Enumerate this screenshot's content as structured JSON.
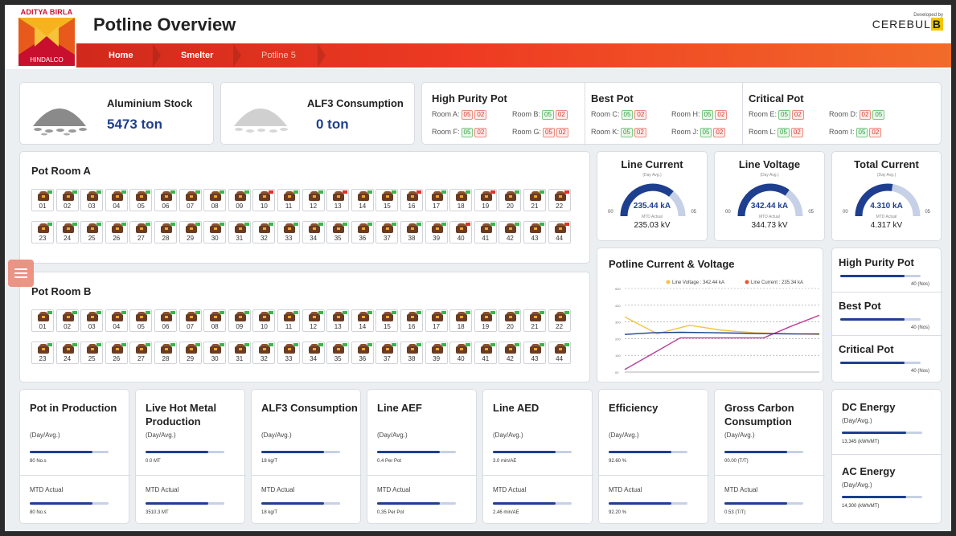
{
  "header": {
    "title": "Potline Overview",
    "logo_top": "ADITYA BIRLA",
    "logo_bottom": "HINDALCO",
    "developed_by": "Developed by",
    "developer": "CEREBUL",
    "developer_suffix": "B"
  },
  "breadcrumb": [
    "Home",
    "Smelter",
    "Potline 5"
  ],
  "stocks": {
    "aluminium": {
      "label": "Aluminium Stock",
      "value": "5473 ton"
    },
    "alf3": {
      "label": "ALF3 Consumption",
      "value": "0 ton"
    }
  },
  "pot_groups": [
    {
      "title": "High Purity Pot",
      "rooms": [
        {
          "label": "Room A:",
          "a": "05",
          "b": "02",
          "a_color": "r",
          "b_color": "r"
        },
        {
          "label": "Room B:",
          "a": "05",
          "b": "02",
          "a_color": "g",
          "b_color": "r"
        },
        {
          "label": "Room F:",
          "a": "05",
          "b": "02",
          "a_color": "g",
          "b_color": "r"
        },
        {
          "label": "Room G:",
          "a": "05",
          "b": "02",
          "a_color": "r",
          "b_color": "r"
        }
      ]
    },
    {
      "title": "Best Pot",
      "rooms": [
        {
          "label": "Room C:",
          "a": "05",
          "b": "02",
          "a_color": "g",
          "b_color": "r"
        },
        {
          "label": "Room H:",
          "a": "05",
          "b": "02",
          "a_color": "g",
          "b_color": "r"
        },
        {
          "label": "Room K:",
          "a": "05",
          "b": "02",
          "a_color": "g",
          "b_color": "r"
        },
        {
          "label": "Room J:",
          "a": "05",
          "b": "02",
          "a_color": "g",
          "b_color": "r"
        }
      ]
    },
    {
      "title": "Critical Pot",
      "rooms": [
        {
          "label": "Room E:",
          "a": "05",
          "b": "02",
          "a_color": "g",
          "b_color": "r"
        },
        {
          "label": "Room D:",
          "a": "02",
          "b": "05",
          "a_color": "r",
          "b_color": "g"
        },
        {
          "label": "Room L:",
          "a": "05",
          "b": "02",
          "a_color": "g",
          "b_color": "r"
        },
        {
          "label": "Room I:",
          "a": "05",
          "b": "02",
          "a_color": "g",
          "b_color": "r"
        }
      ]
    }
  ],
  "pot_rooms": [
    {
      "title": "Pot Room A",
      "row1": [
        "01",
        "02",
        "03",
        "04",
        "05",
        "06",
        "07",
        "08",
        "09",
        "10",
        "11",
        "12",
        "13",
        "14",
        "15",
        "16",
        "17",
        "18",
        "19",
        "20",
        "21",
        "22"
      ],
      "row2": [
        "23",
        "24",
        "25",
        "26",
        "27",
        "28",
        "29",
        "30",
        "31",
        "32",
        "33",
        "34",
        "35",
        "36",
        "37",
        "38",
        "39",
        "40",
        "41",
        "42",
        "43",
        "44"
      ],
      "status1": [
        "g",
        "g",
        "g",
        "g",
        "g",
        "g",
        "g",
        "g",
        "g",
        "r",
        "g",
        "g",
        "r",
        "g",
        "g",
        "r",
        "g",
        "g",
        "r",
        "g",
        "g",
        "r"
      ],
      "status2": [
        "g",
        "g",
        "g",
        "g",
        "g",
        "g",
        "g",
        "g",
        "g",
        "g",
        "g",
        "g",
        "g",
        "g",
        "g",
        "g",
        "g",
        "r",
        "g",
        "g",
        "g",
        "r"
      ]
    },
    {
      "title": "Pot Room B",
      "row1": [
        "01",
        "02",
        "03",
        "04",
        "05",
        "06",
        "07",
        "08",
        "09",
        "10",
        "11",
        "12",
        "13",
        "14",
        "15",
        "16",
        "17",
        "18",
        "19",
        "20",
        "21",
        "22"
      ],
      "row2": [
        "23",
        "24",
        "25",
        "26",
        "27",
        "28",
        "29",
        "30",
        "31",
        "32",
        "33",
        "34",
        "35",
        "36",
        "37",
        "38",
        "39",
        "40",
        "41",
        "42",
        "43",
        "44"
      ],
      "status1": [
        "g",
        "g",
        "g",
        "g",
        "g",
        "g",
        "g",
        "g",
        "g",
        "g",
        "g",
        "g",
        "g",
        "g",
        "g",
        "g",
        "g",
        "g",
        "g",
        "g",
        "g",
        "g"
      ],
      "status2": [
        "g",
        "g",
        "g",
        "g",
        "g",
        "g",
        "g",
        "g",
        "g",
        "g",
        "g",
        "g",
        "g",
        "g",
        "g",
        "g",
        "g",
        "g",
        "g",
        "g",
        "g",
        "g"
      ]
    }
  ],
  "gauges": [
    {
      "title": "Line Current",
      "sub": "(Day Avg.)",
      "min": "00",
      "max": "05",
      "value": "235.44 kA",
      "mtd_label": "MTD Actual",
      "mtd": "235.03 kV",
      "fraction": 0.72
    },
    {
      "title": "Line Voltage",
      "sub": "(Day Avg.)",
      "min": "00",
      "max": "05",
      "value": "342.44 kA",
      "mtd_label": "MTD Actual",
      "mtd": "344.73 kV",
      "fraction": 0.7
    },
    {
      "title": "Total Current",
      "sub": "(Day Avg.)",
      "min": "00",
      "max": "05",
      "value": "4.310 kA",
      "mtd_label": "MTD Actual",
      "mtd": "4.317 kV",
      "fraction": 0.55
    }
  ],
  "chart_data": {
    "type": "line",
    "title": "Potline Current & Voltage",
    "ylim": [
      0,
      500
    ],
    "yticks": [
      "00",
      "100",
      "200",
      "300",
      "400",
      "500"
    ],
    "grid": true,
    "legend_position": "top-right",
    "series": [
      {
        "name": "Line Voltage : 342.44 kA",
        "color": "#f5c342",
        "values": [
          330,
          230,
          280,
          250,
          235,
          230,
          225
        ]
      },
      {
        "name": "Line Current : 235.34 kA",
        "color": "#b9409a",
        "values": [
          15,
          110,
          205,
          205,
          205,
          205,
          275,
          340
        ]
      },
      {
        "name": "",
        "color": "#1e3f8f",
        "values": [
          225,
          235,
          238,
          236,
          233,
          230,
          228,
          228
        ]
      }
    ],
    "legend_dot_colors": [
      "#f5c342",
      "#e8572a"
    ]
  },
  "side_pots": [
    {
      "title": "High Purity Pot",
      "value": "40 (Nos)",
      "fraction": 0.8
    },
    {
      "title": "Best Pot",
      "value": "40 (Nos)",
      "fraction": 0.8
    },
    {
      "title": "Critical Pot",
      "value": "40 (Nos)",
      "fraction": 0.8
    }
  ],
  "kpis": [
    {
      "title": "Pot in Production",
      "sub": "(Day/Avg.)",
      "value": "80 No.s",
      "mtd_label": "MTD Actual",
      "mtd": "80 No.s",
      "fraction": 0.8,
      "mtd_fraction": 0.8
    },
    {
      "title": "Live Hot Metal Production",
      "sub": "(Day/Avg.)",
      "value": "0.0 MT",
      "mtd_label": "MTD Actual",
      "mtd": "3510.3 MT",
      "fraction": 0.8,
      "mtd_fraction": 0.8
    },
    {
      "title": "ALF3 Consumption",
      "sub": "(Day/Avg.)",
      "value": "18 kg/T",
      "mtd_label": "MTD Actual",
      "mtd": "18 kg/T",
      "fraction": 0.8,
      "mtd_fraction": 0.8
    },
    {
      "title": "Line AEF",
      "sub": "(Day/Avg.)",
      "value": "0.4 Per Pot",
      "mtd_label": "MTD Actual",
      "mtd": "0.35 Per Pot",
      "fraction": 0.8,
      "mtd_fraction": 0.8
    },
    {
      "title": "Line AED",
      "sub": "(Day/Avg.)",
      "value": "3.0 min/AE",
      "mtd_label": "MTD Actual",
      "mtd": "2.46 min/AE",
      "fraction": 0.8,
      "mtd_fraction": 0.8
    },
    {
      "title": "Efficiency",
      "sub": "(Day/Avg.)",
      "value": "92.60 %",
      "mtd_label": "MTD Actual",
      "mtd": "92.20 %",
      "fraction": 0.8,
      "mtd_fraction": 0.8
    },
    {
      "title": "Gross Carbon Consumption",
      "sub": "(Day/Avg.)",
      "value": "00.00 (T/T)",
      "mtd_label": "MTD Actual",
      "mtd": "0.53 (T/T)",
      "fraction": 0.8,
      "mtd_fraction": 0.8
    }
  ],
  "energy": [
    {
      "title": "DC Energy",
      "sub": "(Day/Avg.)",
      "value": "13,345 (kWh/MT)",
      "fraction": 0.8
    },
    {
      "title": "AC Energy",
      "sub": "(Day/Avg.)",
      "value": "14,300 (kWh/MT)",
      "fraction": 0.8
    }
  ]
}
